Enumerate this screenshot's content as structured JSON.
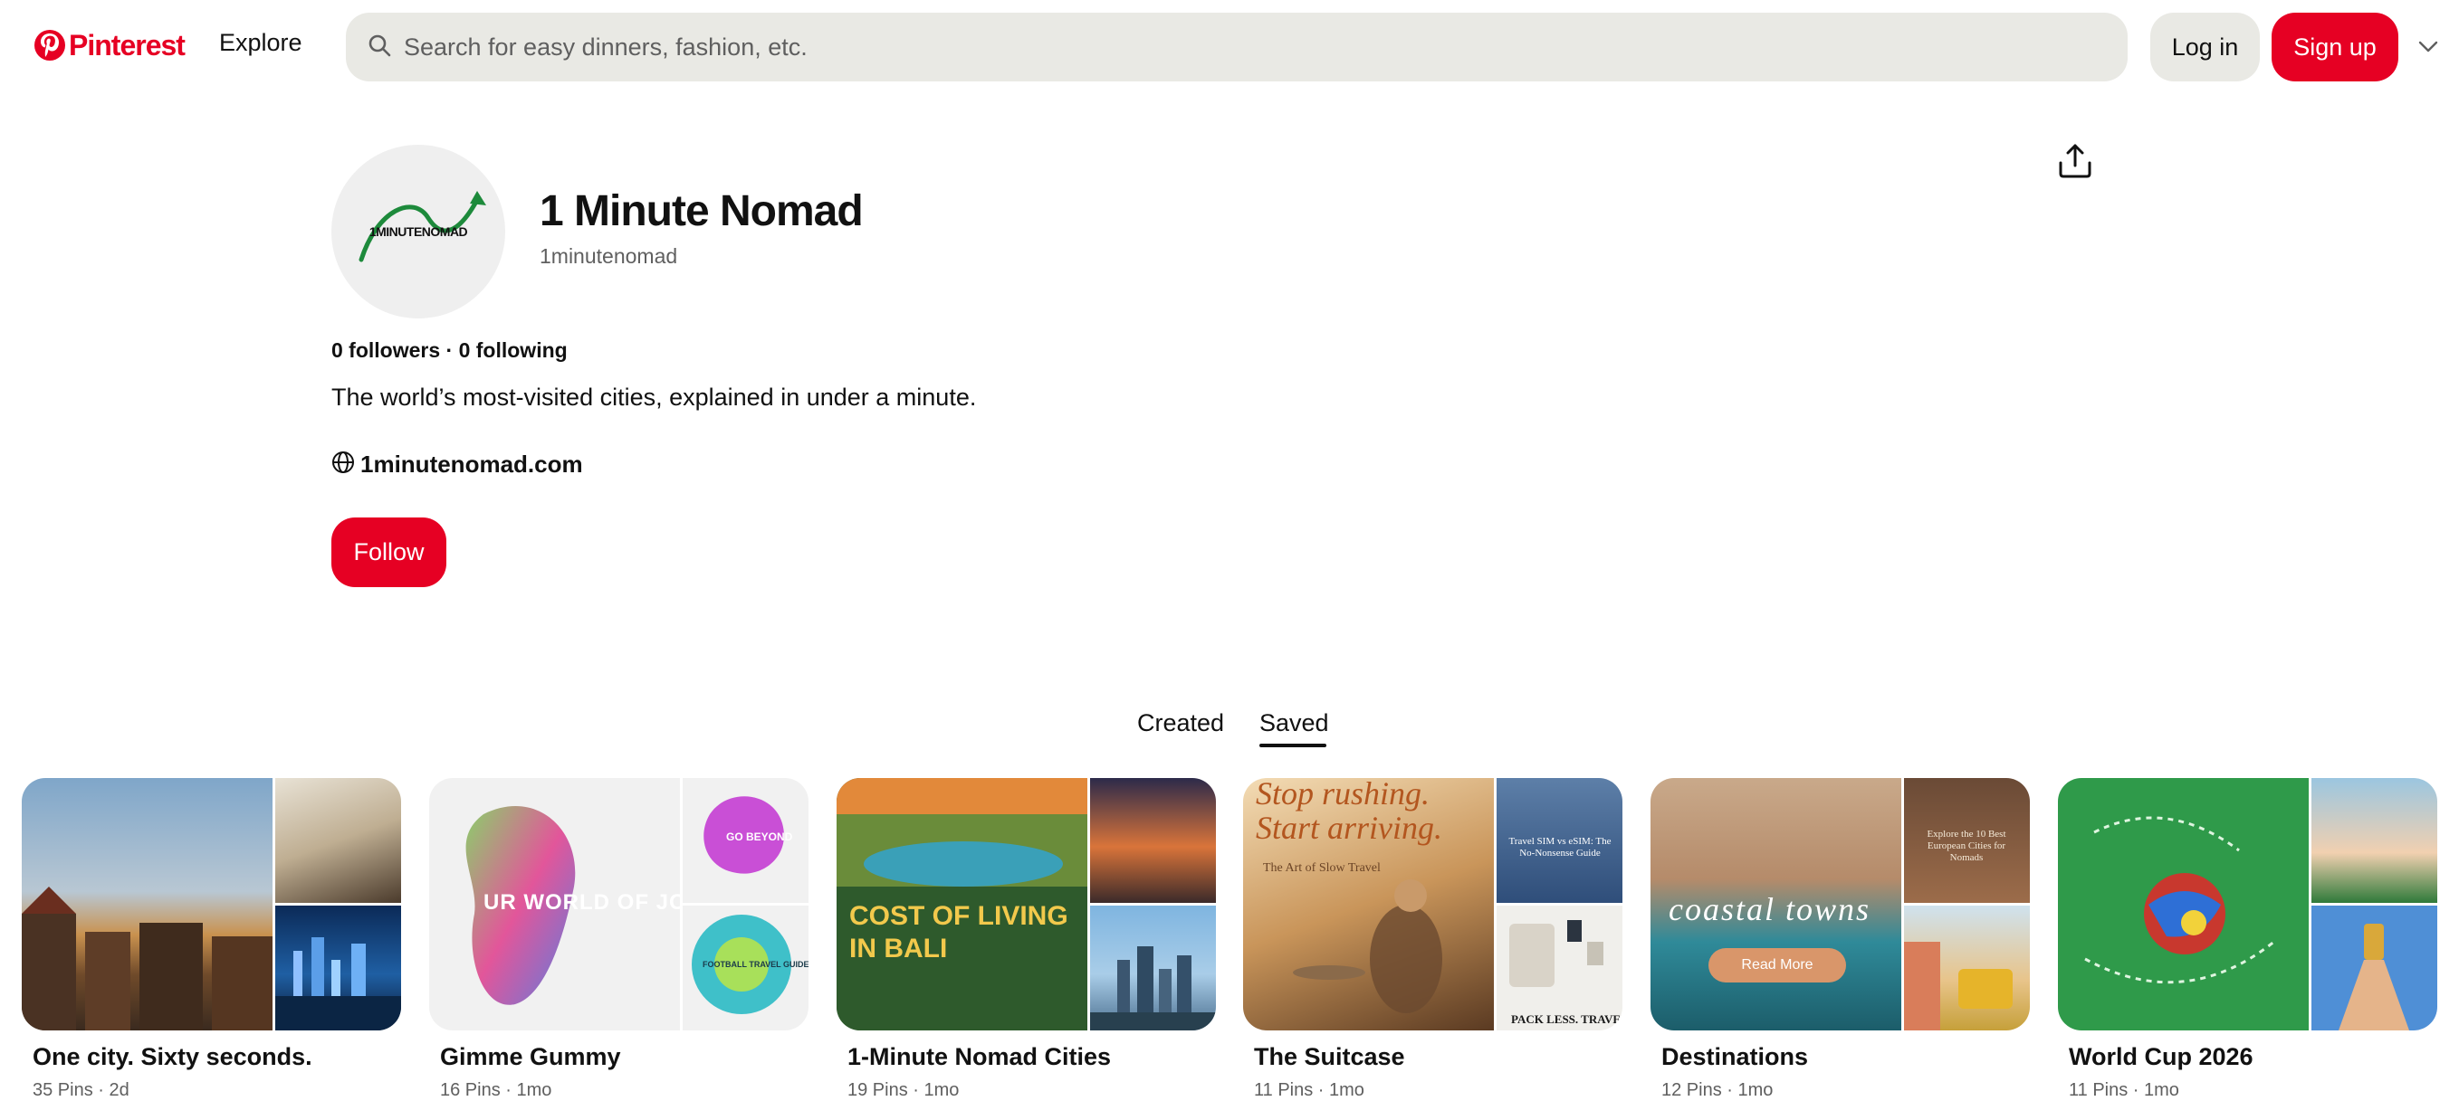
{
  "header": {
    "logo_text": "Pinterest",
    "explore_label": "Explore",
    "search_placeholder": "Search for easy dinners, fashion, etc.",
    "login_label": "Log in",
    "signup_label": "Sign up"
  },
  "profile": {
    "avatar_text": "1MINUTENOMAD",
    "name": "1 Minute Nomad",
    "handle": "1minutenomad",
    "stats": "0 followers · 0 following",
    "bio": "The world’s most-visited cities, explained in under a minute.",
    "website": "1minutenomad.com",
    "follow_label": "Follow"
  },
  "tabs": [
    {
      "label": "Created",
      "active": false
    },
    {
      "label": "Saved",
      "active": true
    }
  ],
  "boards": [
    {
      "title": "One city. Sixty seconds.",
      "meta": "35 Pins · 2d"
    },
    {
      "title": "Gimme Gummy",
      "meta": "16 Pins · 1mo",
      "overlays": [
        "UR WORLD OF JOY",
        "GO BEYOND",
        "FOOTBALL TRAVEL GUIDE"
      ]
    },
    {
      "title": "1-Minute Nomad Cities",
      "meta": "19 Pins · 1mo",
      "overlays": [
        "COST OF LIVING",
        "IN BALI"
      ]
    },
    {
      "title": "The Suitcase",
      "meta": "11 Pins · 1mo",
      "overlays": [
        "Stop rushing.",
        "Start arriving.",
        "The Art of Slow Travel",
        "Travel SIM vs eSIM: The No-Nonsense Guide",
        "PACK LESS. TRAVEL"
      ]
    },
    {
      "title": "Destinations",
      "meta": "12 Pins · 1mo",
      "overlays": [
        "coastal towns",
        "Read More",
        "Explore the 10 Best European Cities for Nomads"
      ]
    },
    {
      "title": "World Cup 2026",
      "meta": "11 Pins · 1mo"
    }
  ],
  "colors": {
    "brand_red": "#e60023",
    "search_bg": "#e9e9e4",
    "muted_text": "#5f5f5f"
  }
}
